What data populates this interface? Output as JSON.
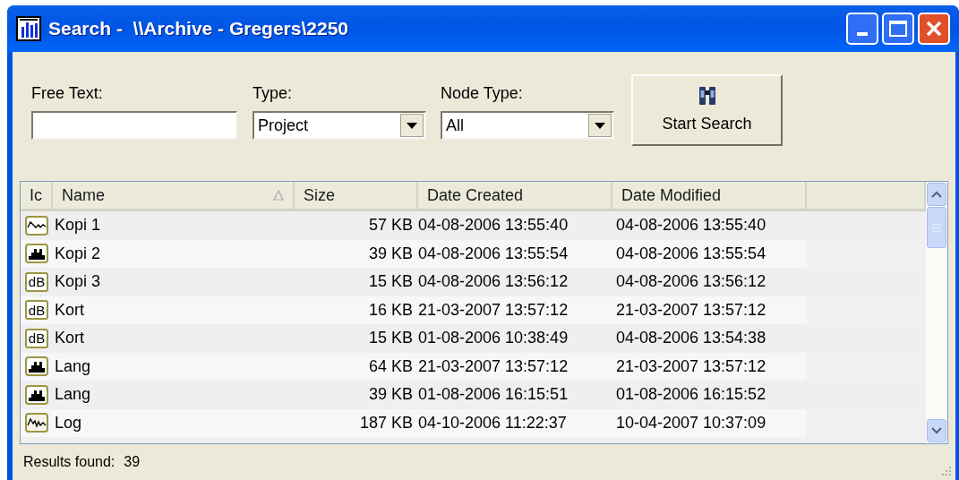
{
  "window": {
    "title": "Search -  \\\\Archive - Gregers\\2250"
  },
  "filters": {
    "free_text": {
      "label": "Free Text:"
    },
    "type": {
      "label": "Type:",
      "value": "Project"
    },
    "node_type": {
      "label": "Node Type:",
      "value": "All"
    },
    "search_button": "Start Search"
  },
  "table": {
    "columns": [
      {
        "label": "Ic"
      },
      {
        "label": "Name",
        "sorted": true
      },
      {
        "label": "Size"
      },
      {
        "label": "Date Created"
      },
      {
        "label": "Date Modified"
      }
    ],
    "rows": [
      {
        "icon": {
          "kind": "wave"
        },
        "name": "Kopi 1",
        "size": "57 KB",
        "created": "04-08-2006 13:55:40",
        "modified": "04-08-2006 13:55:40"
      },
      {
        "icon": {
          "kind": "peaks"
        },
        "name": "Kopi 2",
        "size": "39 KB",
        "created": "04-08-2006 13:55:54",
        "modified": "04-08-2006 13:55:54"
      },
      {
        "icon": {
          "kind": "db",
          "text": "dB"
        },
        "name": "Kopi 3",
        "size": "15 KB",
        "created": "04-08-2006 13:56:12",
        "modified": "04-08-2006 13:56:12"
      },
      {
        "icon": {
          "kind": "db",
          "text": "dB"
        },
        "name": "Kort",
        "size": "16 KB",
        "created": "21-03-2007 13:57:12",
        "modified": "21-03-2007 13:57:12"
      },
      {
        "icon": {
          "kind": "db",
          "text": "dB"
        },
        "name": "Kort",
        "size": "15 KB",
        "created": "01-08-2006 10:38:49",
        "modified": "04-08-2006 13:54:38"
      },
      {
        "icon": {
          "kind": "peaks"
        },
        "name": "Lang",
        "size": "64 KB",
        "created": "21-03-2007 13:57:12",
        "modified": "21-03-2007 13:57:12"
      },
      {
        "icon": {
          "kind": "peaks"
        },
        "name": "Lang",
        "size": "39 KB",
        "created": "01-08-2006 16:15:51",
        "modified": "01-08-2006 16:15:52"
      },
      {
        "icon": {
          "kind": "log"
        },
        "name": "Log",
        "size": "187 KB",
        "created": "04-10-2006 11:22:37",
        "modified": "10-04-2007 10:37:09"
      }
    ]
  },
  "status_bar": {
    "label": "Results found:",
    "count": "39"
  }
}
